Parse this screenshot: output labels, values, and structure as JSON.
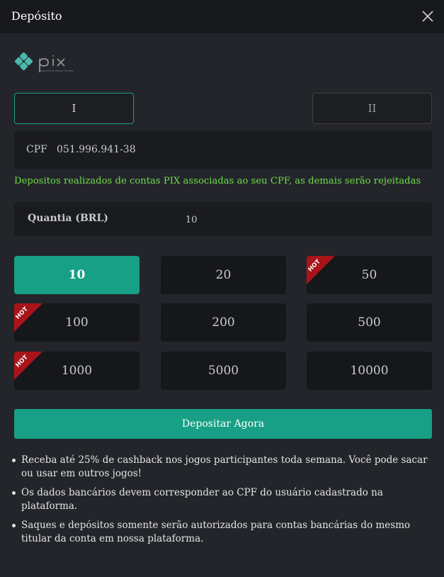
{
  "header": {
    "title": "Depósito"
  },
  "logo": {
    "text": "pix",
    "subtext": "powered by Banco Central"
  },
  "tabs": [
    {
      "label": "I",
      "active": true
    },
    {
      "label": "II",
      "active": false
    }
  ],
  "cpf": {
    "label": "CPF",
    "value": "051.996.941-38"
  },
  "notice": "Depositos realizados de contas PIX associadas ao seu CPF, as demais serão rejeitadas",
  "amount": {
    "label": "Quantia (BRL)",
    "value": "10"
  },
  "hot_label": "HOT",
  "options": [
    {
      "value": "10",
      "selected": true,
      "hot": false
    },
    {
      "value": "20",
      "selected": false,
      "hot": false
    },
    {
      "value": "50",
      "selected": false,
      "hot": true
    },
    {
      "value": "100",
      "selected": false,
      "hot": true
    },
    {
      "value": "200",
      "selected": false,
      "hot": false
    },
    {
      "value": "500",
      "selected": false,
      "hot": false
    },
    {
      "value": "1000",
      "selected": false,
      "hot": true
    },
    {
      "value": "5000",
      "selected": false,
      "hot": false
    },
    {
      "value": "10000",
      "selected": false,
      "hot": false
    }
  ],
  "deposit_button": "Depositar Agora",
  "info": [
    "Receba até 25% de cashback nos jogos participantes toda semana. Você pode sacar ou usar em outros jogos!",
    "Os dados bancários devem corresponder ao CPF do usuário cadastrado na plataforma.",
    "Saques e depósitos somente serão autorizados para contas bancárias do mesmo titular da conta em nossa plataforma."
  ],
  "colors": {
    "accent": "#17a086",
    "notice": "#6fdc4a",
    "hot": "#a8141a"
  }
}
